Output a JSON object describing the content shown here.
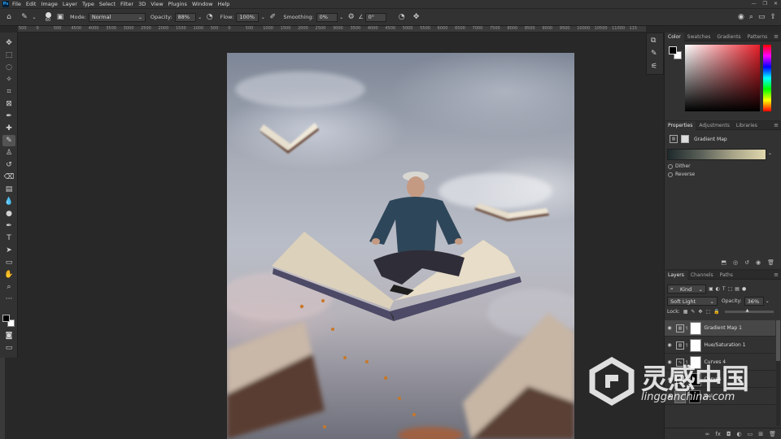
{
  "menubar": {
    "logo": "Ps",
    "items": [
      "File",
      "Edit",
      "Image",
      "Layer",
      "Type",
      "Select",
      "Filter",
      "3D",
      "View",
      "Plugins",
      "Window",
      "Help"
    ]
  },
  "options": {
    "brush_size": "60",
    "mode_label": "Mode:",
    "mode_value": "Normal",
    "opacity_label": "Opacity:",
    "opacity_value": "88%",
    "flow_label": "Flow:",
    "flow_value": "100%",
    "smoothing_label": "Smoothing:",
    "smoothing_value": "0%",
    "angle_value": "0°"
  },
  "ruler": {
    "ticks": [
      "500",
      "0",
      "500",
      "4500",
      "4000",
      "3500",
      "3000",
      "2500",
      "2000",
      "1500",
      "1000",
      "500",
      "0",
      "500",
      "1000",
      "1500",
      "2000",
      "2500",
      "3000",
      "3500",
      "4000",
      "4500",
      "5000",
      "5500",
      "6000",
      "6500",
      "7000",
      "7500",
      "8000",
      "8500",
      "9000",
      "9500",
      "10000",
      "10500",
      "11000",
      "115"
    ]
  },
  "color_panel": {
    "tabs": [
      "Color",
      "Swatches",
      "Gradients",
      "Patterns"
    ],
    "hue_color": "#e8202a"
  },
  "properties": {
    "tabs": [
      "Properties",
      "Adjustments",
      "Libraries"
    ],
    "title": "Gradient Map",
    "dither": "Dither",
    "reverse": "Reverse"
  },
  "layers_panel": {
    "tabs": [
      "Layers",
      "Channels",
      "Paths"
    ],
    "filter_kind": "Kind",
    "blend_mode": "Soft Light",
    "opacity_label": "Opacity:",
    "opacity_value": "36%",
    "lock_label": "Lock:",
    "layers": [
      {
        "name": "Gradient Map 1"
      },
      {
        "name": "Hue/Saturation 1"
      },
      {
        "name": "Curves 4"
      },
      {
        "name": "Curves"
      },
      {
        "name": "Joel"
      }
    ]
  },
  "watermark": {
    "brand": "灵感中国",
    "url": "lingganchina.com"
  }
}
